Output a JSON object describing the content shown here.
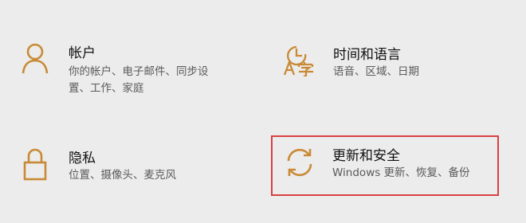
{
  "accent_color": "#c98a36",
  "highlight_color": "#d94141",
  "tiles": {
    "accounts": {
      "icon": "person-icon",
      "title": "帐户",
      "desc_line1": "你的帐户、电子邮件、同步设",
      "desc_line2": "置、工作、家庭"
    },
    "time_language": {
      "icon": "time-language-icon",
      "title": "时间和语言",
      "desc_line1": "语音、区域、日期"
    },
    "privacy": {
      "icon": "lock-icon",
      "title": "隐私",
      "desc_line1": "位置、摄像头、麦克风"
    },
    "update_security": {
      "icon": "sync-arrows-icon",
      "title": "更新和安全",
      "desc_line1": "Windows 更新、恢复、备份"
    }
  }
}
